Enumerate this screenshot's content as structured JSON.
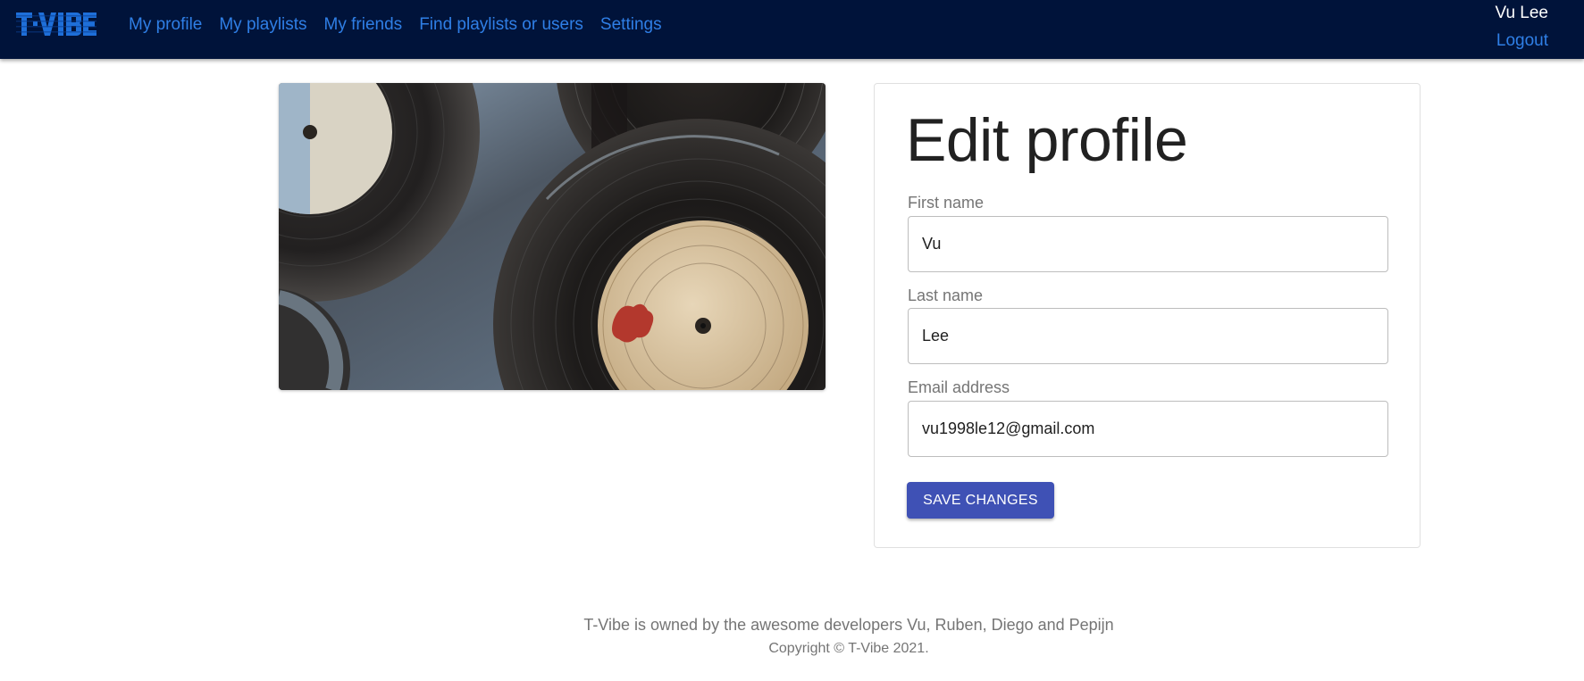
{
  "app": {
    "logo_text": "T-VIBE",
    "colors": {
      "navbar_bg": "#00133a",
      "link": "#2f7fe6",
      "button_primary": "#3f51b5"
    }
  },
  "nav": {
    "items": [
      {
        "label": "My profile"
      },
      {
        "label": "My playlists"
      },
      {
        "label": "My friends"
      },
      {
        "label": "Find playlists or users"
      },
      {
        "label": "Settings"
      }
    ]
  },
  "user": {
    "name": "Vu Lee",
    "logout_label": "Logout"
  },
  "form": {
    "title": "Edit profile",
    "first_name": {
      "label": "First name",
      "value": "Vu"
    },
    "last_name": {
      "label": "Last name",
      "value": "Lee"
    },
    "email": {
      "label": "Email address",
      "value": "vu1998le12@gmail.com"
    },
    "save_label": "SAVE CHANGES"
  },
  "footer": {
    "text": "T-Vibe is owned by the awesome developers Vu, Ruben, Diego and Pepijn",
    "copyright": "Copyright © T-Vibe 2021."
  }
}
